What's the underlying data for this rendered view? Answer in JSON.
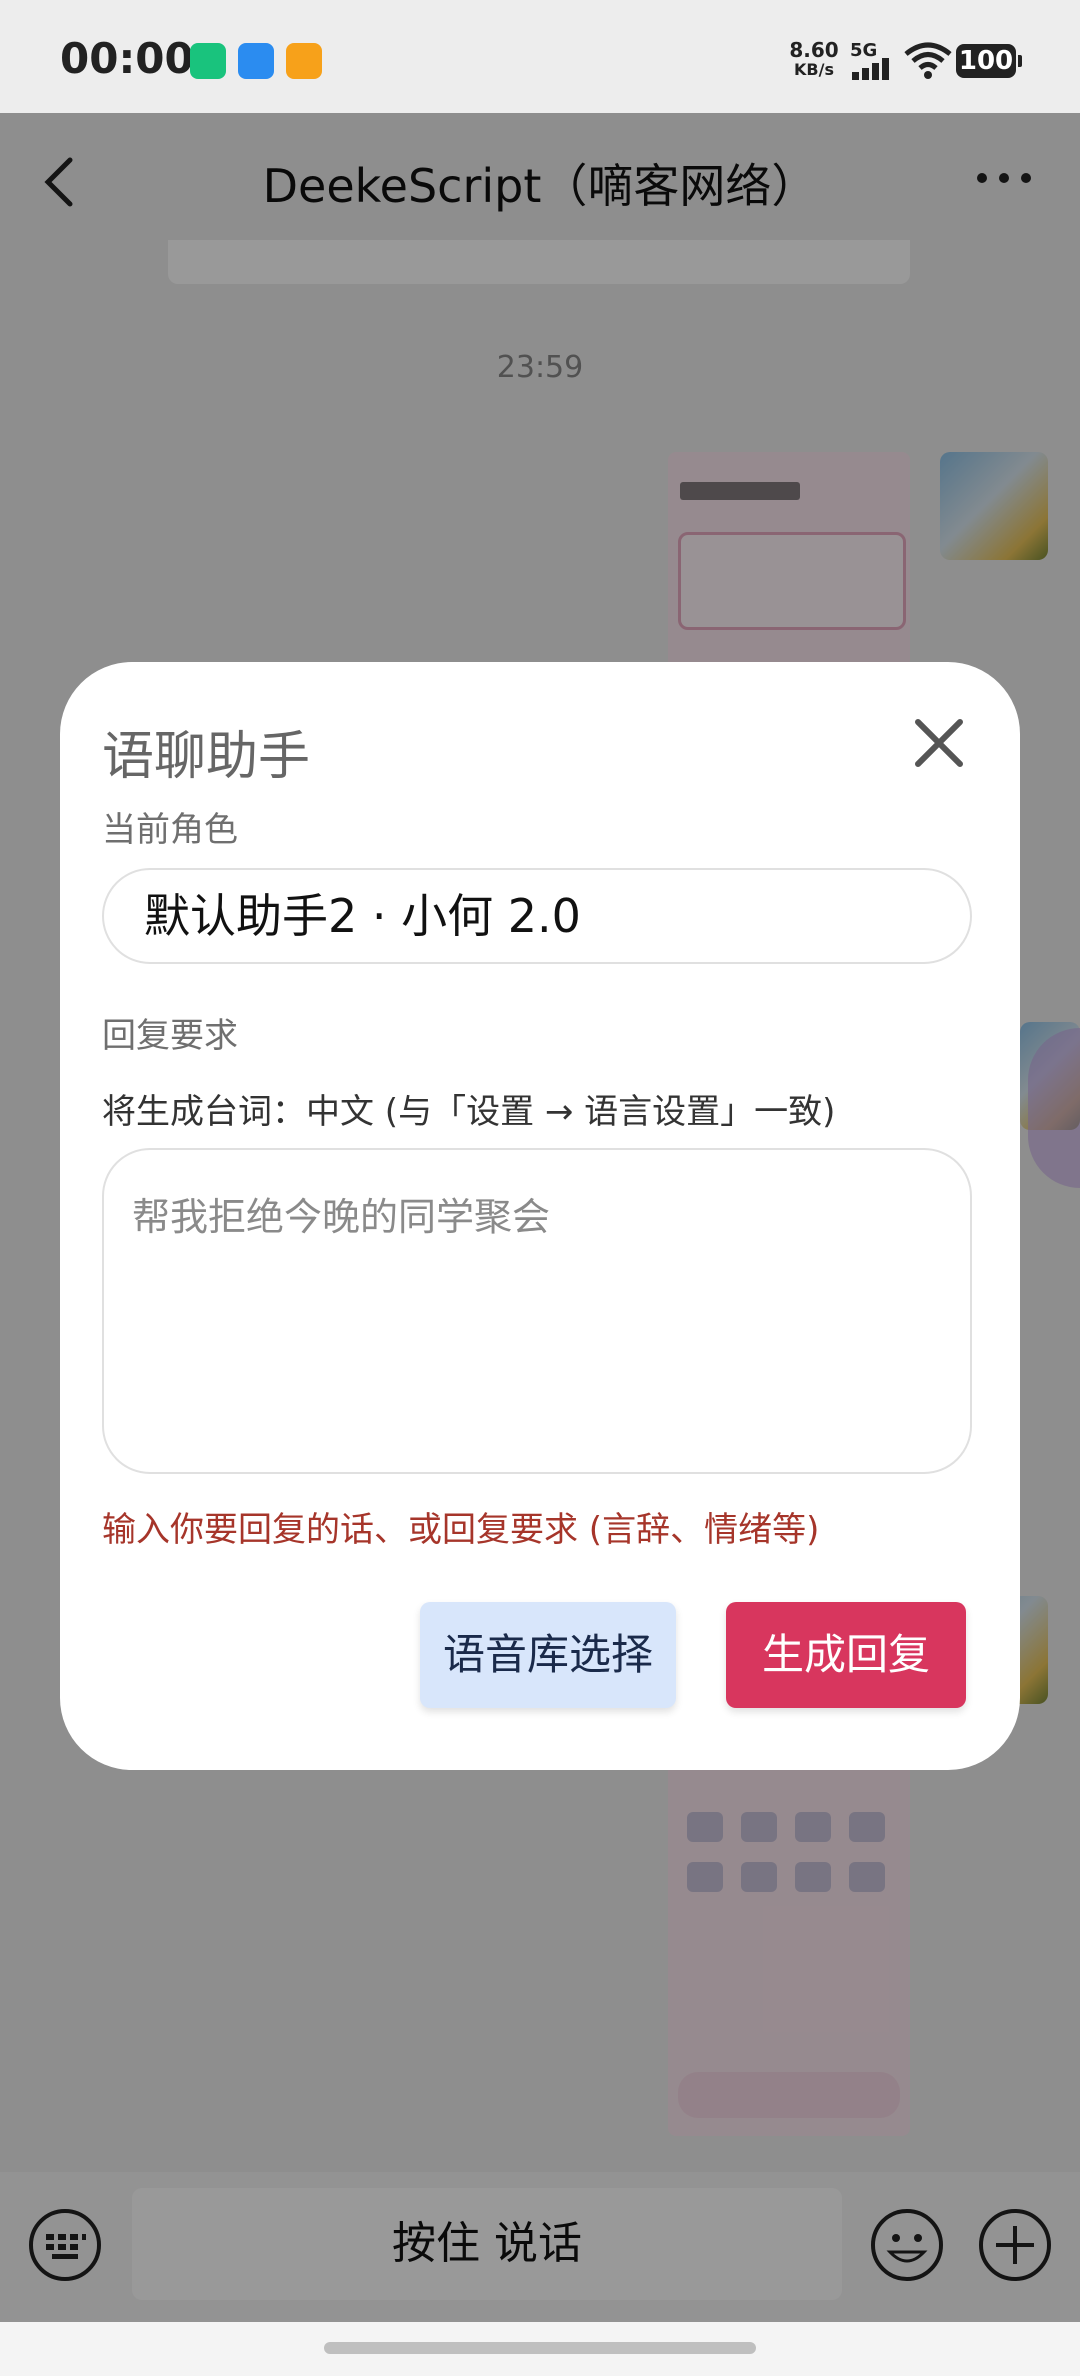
{
  "status_bar": {
    "time": "00:00",
    "net_speed_value": "8.60",
    "net_speed_unit": "KB/s",
    "network": "5G",
    "battery": "100"
  },
  "chat": {
    "title": "DeekeScript（嘀客网络）",
    "timestamp": "23:59",
    "voice_button": "按住 说话"
  },
  "dialog": {
    "title": "语聊助手",
    "current_role_label": "当前角色",
    "current_role_value": "默认助手2 · 小何 2.0",
    "reply_requirement_label": "回复要求",
    "language_note": "将生成台词：中文 (与「设置 → 语言设置」一致)",
    "reply_placeholder": "帮我拒绝今晚的同学聚会",
    "hint": "输入你要回复的话、或回复要求 (言辞、情绪等)",
    "voice_library_button": "语音库选择",
    "generate_button": "生成回复"
  },
  "colors": {
    "primary_button": "#d8365e",
    "secondary_button": "#d8e6fb",
    "hint_text": "#a6352a"
  }
}
